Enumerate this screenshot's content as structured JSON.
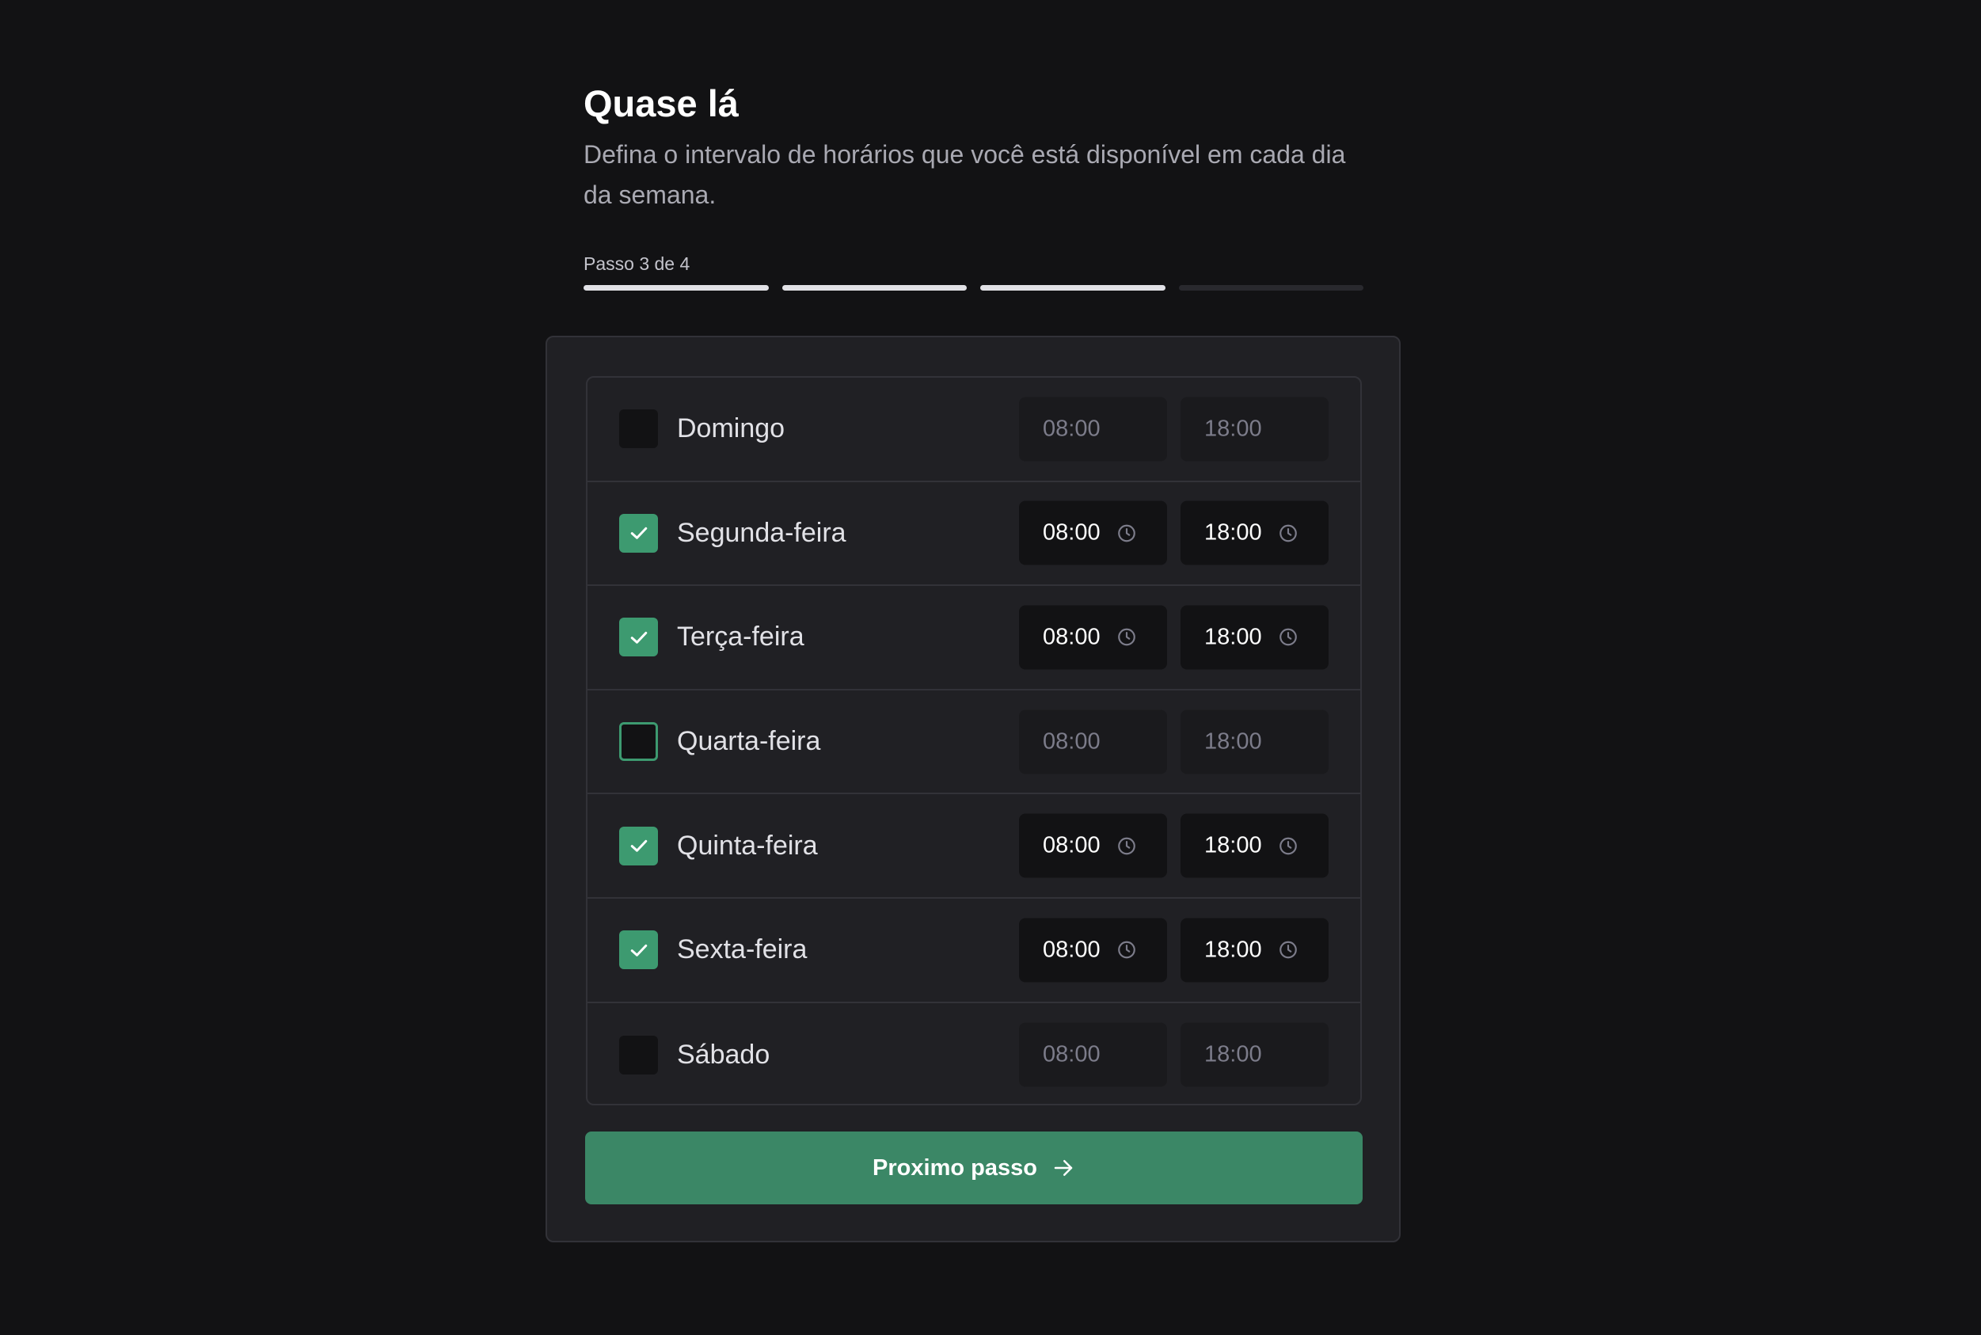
{
  "header": {
    "title": "Quase lá",
    "subtitle": "Defina o intervalo de horários que você está disponível em cada dia da semana."
  },
  "progress": {
    "label": "Passo 3 de 4",
    "current": 3,
    "total": 4
  },
  "days": [
    {
      "name": "Domingo",
      "enabled": false,
      "start": "08:00",
      "end": "18:00"
    },
    {
      "name": "Segunda-feira",
      "enabled": true,
      "start": "08:00",
      "end": "18:00"
    },
    {
      "name": "Terça-feira",
      "enabled": true,
      "start": "08:00",
      "end": "18:00"
    },
    {
      "name": "Quarta-feira",
      "enabled": false,
      "focused": true,
      "start": "08:00",
      "end": "18:00"
    },
    {
      "name": "Quinta-feira",
      "enabled": true,
      "start": "08:00",
      "end": "18:00"
    },
    {
      "name": "Sexta-feira",
      "enabled": true,
      "start": "08:00",
      "end": "18:00"
    },
    {
      "name": "Sábado",
      "enabled": false,
      "start": "08:00",
      "end": "18:00"
    }
  ],
  "button": {
    "label": "Proximo passo",
    "icon": "arrow-right-icon"
  },
  "colors": {
    "accent": "#3b8766",
    "checkbox_checked": "#3d9a70",
    "background": "#121214",
    "card": "#202024"
  }
}
